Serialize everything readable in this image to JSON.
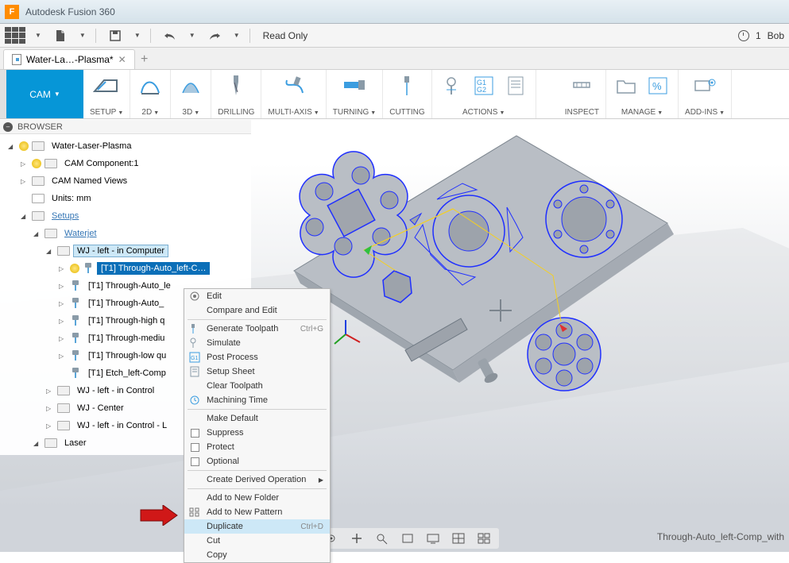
{
  "title_bar": {
    "app": "Autodesk Fusion 360",
    "logo_letter": "F"
  },
  "top_toolbar": {
    "readonly": "Read Only",
    "save_count": "1",
    "user": "Bob"
  },
  "tabs": {
    "active": "Water-La…-Plasma*"
  },
  "ribbon": {
    "workspace": "CAM",
    "groups": {
      "setup": "SETUP",
      "2d": "2D",
      "3d": "3D",
      "drilling": "DRILLING",
      "multiaxis": "MULTI-AXIS",
      "turning": "TURNING",
      "cutting": "CUTTING",
      "actions": "ACTIONS",
      "inspect": "INSPECT",
      "manage": "MANAGE",
      "addins": "ADD-INS"
    }
  },
  "browser": {
    "header": "BROWSER",
    "root": "Water-Laser-Plasma",
    "cam_component": "CAM Component:1",
    "named_views": "CAM Named Views",
    "units": "Units: mm",
    "setups": "Setups",
    "waterjet": "Waterjet",
    "wj_left_comp": "WJ - left - in Computer",
    "tp_sel": "[T1] Through-Auto_left-C…",
    "tp_1": "[T1] Through-Auto_le",
    "tp_2": "[T1] Through-Auto_",
    "tp_3": "[T1] Through-high q",
    "tp_4": "[T1] Through-mediu",
    "tp_5": "[T1] Through-low qu",
    "tp_6": "[T1] Etch_left-Comp",
    "wj_left_ctrl": "WJ - left - in Control",
    "wj_center": "WJ - Center",
    "wj_left_ctrl_l": "WJ - left - in Control - L",
    "laser": "Laser"
  },
  "context_menu": {
    "edit": "Edit",
    "compare": "Compare and Edit",
    "generate": "Generate Toolpath",
    "generate_key": "Ctrl+G",
    "simulate": "Simulate",
    "post": "Post Process",
    "setupsheet": "Setup Sheet",
    "clear": "Clear Toolpath",
    "machtime": "Machining Time",
    "makedef": "Make Default",
    "suppress": "Suppress",
    "protect": "Protect",
    "optional": "Optional",
    "derived": "Create Derived Operation",
    "addfolder": "Add to New Folder",
    "addpattern": "Add to New Pattern",
    "duplicate": "Duplicate",
    "duplicate_key": "Ctrl+D",
    "cut": "Cut",
    "copy": "Copy"
  },
  "viewport": {
    "selection_label": "Through-Auto_left-Comp_with"
  }
}
